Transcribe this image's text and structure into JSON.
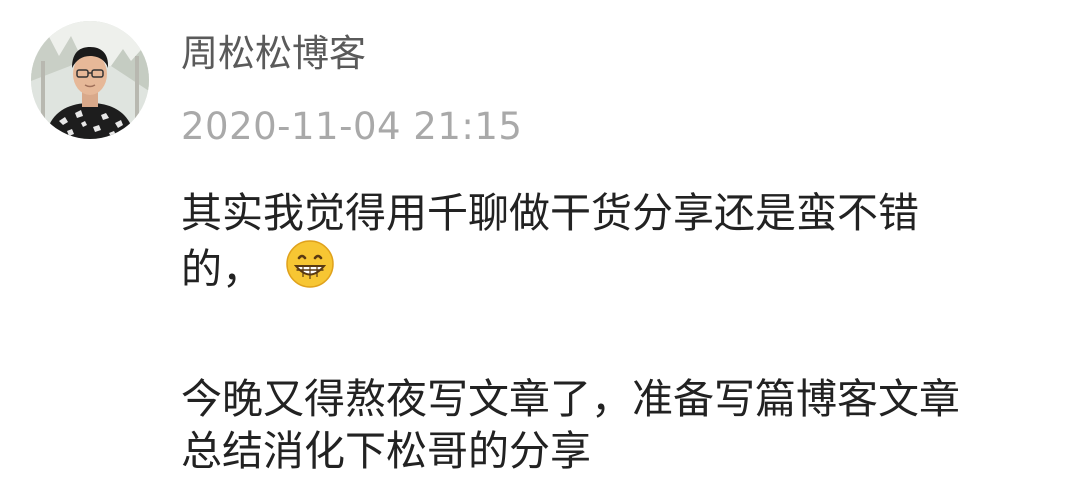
{
  "post": {
    "author": "周松松博客",
    "timestamp": "2020-11-04 21:15",
    "avatar_icon": "user-photo",
    "paragraphs": [
      {
        "lines": [
          "其实我觉得用千聊做干货分享还是蛮不错",
          "的，"
        ],
        "emoji": "grinning-face-emoji"
      },
      {
        "lines": [
          "今晚又得熬夜写文章了，准备写篇博客文章",
          "总结消化下松哥的分享"
        ]
      }
    ]
  },
  "colors": {
    "author": "#5a5a5a",
    "timestamp": "#a9a9a9",
    "body_text": "#222222",
    "emoji_face": "#f7c633"
  }
}
